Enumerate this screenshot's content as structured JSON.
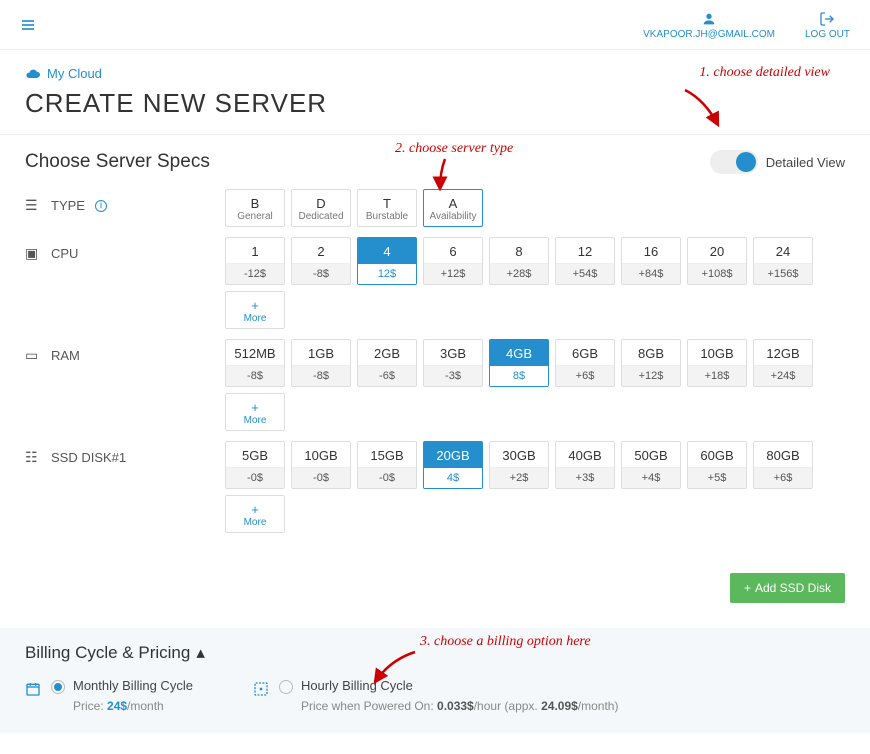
{
  "topbar": {
    "user_email": "VKAPOOR.JH@GMAIL.COM",
    "logout": "LOG OUT"
  },
  "breadcrumb": {
    "my_cloud": "My Cloud"
  },
  "page_title": "CREATE NEW SERVER",
  "specs": {
    "heading": "Choose Server Specs",
    "detailed_view_label": "Detailed View",
    "type_label": "TYPE",
    "cpu_label": "CPU",
    "ram_label": "RAM",
    "ssd_label": "SSD DISK#1",
    "more_label": "More",
    "type_options": [
      {
        "code": "B",
        "name": "General"
      },
      {
        "code": "D",
        "name": "Dedicated"
      },
      {
        "code": "T",
        "name": "Burstable"
      },
      {
        "code": "A",
        "name": "Availability"
      }
    ],
    "cpu_options": [
      {
        "val": "1",
        "price": "-12$"
      },
      {
        "val": "2",
        "price": "-8$"
      },
      {
        "val": "4",
        "price": "12$"
      },
      {
        "val": "6",
        "price": "+12$"
      },
      {
        "val": "8",
        "price": "+28$"
      },
      {
        "val": "12",
        "price": "+54$"
      },
      {
        "val": "16",
        "price": "+84$"
      },
      {
        "val": "20",
        "price": "+108$"
      },
      {
        "val": "24",
        "price": "+156$"
      }
    ],
    "ram_options": [
      {
        "val": "512MB",
        "price": "-8$"
      },
      {
        "val": "1GB",
        "price": "-8$"
      },
      {
        "val": "2GB",
        "price": "-6$"
      },
      {
        "val": "3GB",
        "price": "-3$"
      },
      {
        "val": "4GB",
        "price": "8$"
      },
      {
        "val": "6GB",
        "price": "+6$"
      },
      {
        "val": "8GB",
        "price": "+12$"
      },
      {
        "val": "10GB",
        "price": "+18$"
      },
      {
        "val": "12GB",
        "price": "+24$"
      }
    ],
    "ssd_options": [
      {
        "val": "5GB",
        "price": "-0$"
      },
      {
        "val": "10GB",
        "price": "-0$"
      },
      {
        "val": "15GB",
        "price": "-0$"
      },
      {
        "val": "20GB",
        "price": "4$"
      },
      {
        "val": "30GB",
        "price": "+2$"
      },
      {
        "val": "40GB",
        "price": "+3$"
      },
      {
        "val": "50GB",
        "price": "+4$"
      },
      {
        "val": "60GB",
        "price": "+5$"
      },
      {
        "val": "80GB",
        "price": "+6$"
      }
    ],
    "add_ssd_label": "Add SSD Disk"
  },
  "billing": {
    "heading": "Billing Cycle & Pricing",
    "monthly_label": "Monthly Billing Cycle",
    "monthly_price_prefix": "Price: ",
    "monthly_price_value": "24$",
    "monthly_price_suffix": "/month",
    "hourly_label": "Hourly Billing Cycle",
    "hourly_prefix": "Price when Powered On: ",
    "hourly_rate": "0.033$",
    "hourly_suffix1": "/hour (appx. ",
    "hourly_month": "24.09$",
    "hourly_suffix2": "/month)"
  },
  "annotations": {
    "a1": "1. choose detailed view",
    "a2": "2. choose server type",
    "a3": "3. choose a billing option here"
  }
}
